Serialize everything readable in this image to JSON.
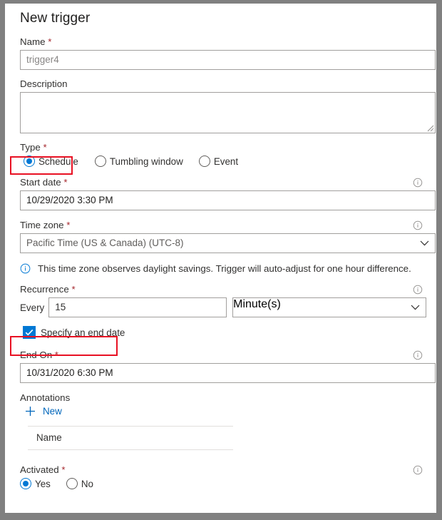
{
  "panel": {
    "title": "New trigger"
  },
  "colors": {
    "accent": "#0078d4",
    "required": "#a4262c",
    "highlight": "#e81123",
    "link": "#0066bb",
    "border": "#a19f9d",
    "frame": "#808080"
  },
  "fields": {
    "name": {
      "label": "Name",
      "required": "*",
      "value": "trigger4"
    },
    "description": {
      "label": "Description",
      "value": ""
    },
    "type": {
      "label": "Type",
      "required": "*",
      "options": [
        {
          "label": "Schedule",
          "selected": true
        },
        {
          "label": "Tumbling window",
          "selected": false
        },
        {
          "label": "Event",
          "selected": false
        }
      ]
    },
    "start_date": {
      "label": "Start date",
      "required": "*",
      "value": "10/29/2020 3:30 PM",
      "info_icon": "info-icon"
    },
    "time_zone": {
      "label": "Time zone",
      "required": "*",
      "value": "Pacific Time (US & Canada) (UTC-8)",
      "info_icon": "info-icon",
      "chevron_icon": "chevron-down-icon"
    },
    "daylight_message": {
      "icon": "info-icon",
      "text": "This time zone observes daylight savings. Trigger will auto-adjust for one hour difference."
    },
    "recurrence": {
      "label": "Recurrence",
      "required": "*",
      "every_label": "Every",
      "interval_value": "15",
      "unit_value": "Minute(s)",
      "info_icon": "info-icon",
      "chevron_icon": "chevron-down-icon"
    },
    "specify_end_date": {
      "label": "Specify an end date",
      "checked": true,
      "icon": "checkmark-icon"
    },
    "end_on": {
      "label": "End On",
      "required": "*",
      "value": "10/31/2020 6:30 PM",
      "info_icon": "info-icon"
    },
    "annotations": {
      "label": "Annotations",
      "new_label": "New",
      "new_icon": "plus-icon",
      "column_header": "Name"
    },
    "activated": {
      "label": "Activated",
      "required": "*",
      "info_icon": "info-icon",
      "options": [
        {
          "label": "Yes",
          "selected": true
        },
        {
          "label": "No",
          "selected": false
        }
      ]
    }
  }
}
